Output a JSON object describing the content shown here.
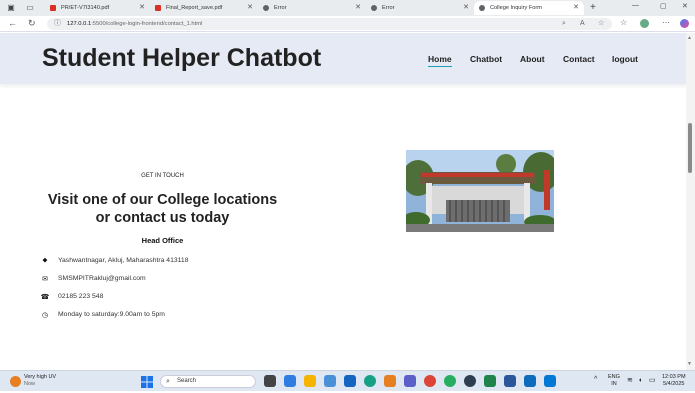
{
  "browser": {
    "tabs": [
      {
        "title": "PR/ET-V7I3140.pdf",
        "icon": "pdf-icon",
        "color": "#d93025"
      },
      {
        "title": "Final_Report_save.pdf",
        "icon": "pdf-icon",
        "color": "#d93025"
      },
      {
        "title": "Error",
        "icon": "globe-icon",
        "color": "#5f6368"
      },
      {
        "title": "Error",
        "icon": "globe-icon",
        "color": "#5f6368"
      },
      {
        "title": "College Inquiry Form",
        "icon": "globe-icon",
        "color": "#5f6368"
      }
    ],
    "url_host": "127.0.0.1",
    "url_path": ":5500/college-login-frontend/contact_1.html"
  },
  "site": {
    "brand": "Student Helper Chatbot",
    "nav": [
      "Home",
      "Chatbot",
      "About",
      "Contact",
      "logout"
    ],
    "active_nav": "Home"
  },
  "contact": {
    "kicker": "GET IN TOUCH",
    "headline": "Visit one of our College locations or contact us today",
    "office_title": "Head Office",
    "items": [
      {
        "icon": "map-pin-icon",
        "glyph": "◆",
        "text": "Yashwantnagar, Akluj, Maharashtra 413118"
      },
      {
        "icon": "email-icon",
        "glyph": "✉",
        "text": "SMSMPITRakluj@gmail.com"
      },
      {
        "icon": "phone-icon",
        "glyph": "☎",
        "text": "02185 223 548"
      },
      {
        "icon": "clock-icon",
        "glyph": "◷",
        "text": "Monday to saturday:9.00am to 5pm"
      }
    ]
  },
  "taskbar": {
    "weather_title": "Very high UV",
    "weather_sub": "Now",
    "search_placeholder": "Search",
    "lang_top": "ENG",
    "lang_bottom": "IN",
    "time": "12:03 PM",
    "date": "5/4/2025"
  },
  "colors": {
    "header_bg": "#e6eaf5",
    "nav_underline": "#1f9fb5"
  }
}
